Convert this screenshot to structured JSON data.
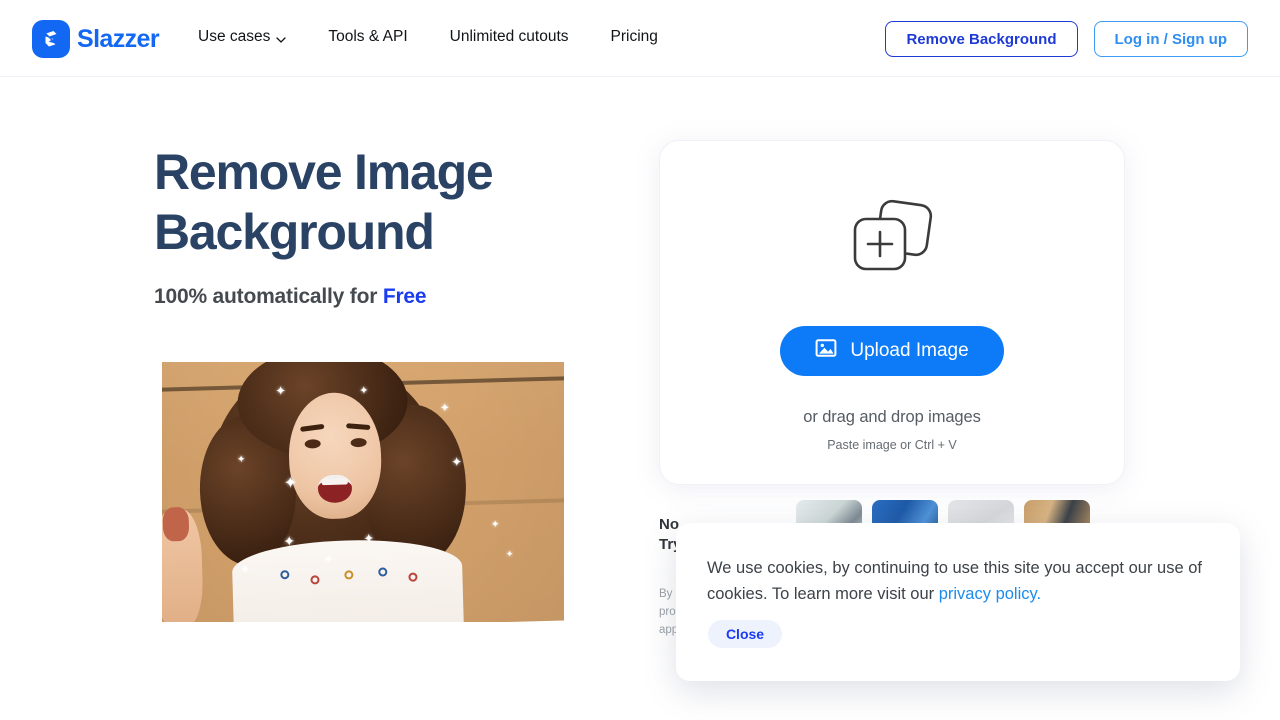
{
  "header": {
    "logo": {
      "text": "Slazzer",
      "icon": "slazzer-logo-icon",
      "brand_color": "#1268f3"
    },
    "nav": [
      {
        "label": "Use cases",
        "has_dropdown": true
      },
      {
        "label": "Tools & API",
        "has_dropdown": false
      },
      {
        "label": "Unlimited cutouts",
        "has_dropdown": false
      },
      {
        "label": "Pricing",
        "has_dropdown": false
      }
    ],
    "actions": {
      "remove_background": "Remove Background",
      "login_signup": "Log in / Sign up"
    }
  },
  "hero": {
    "headline": "Remove Image Background",
    "subhead_prefix": "100% automatically for ",
    "subhead_highlight": "Free",
    "photo_alt": "woman-with-curly-hair-photo"
  },
  "upload": {
    "stack_icon": "add-images-icon",
    "button_label": "Upload Image",
    "button_icon": "image-icon",
    "drag_text": "or drag and drop images",
    "paste_text": "Paste image or Ctrl + V",
    "button_color": "#0d7bf7"
  },
  "thumbnails": [
    {
      "name": "sample-1"
    },
    {
      "name": "sample-2"
    },
    {
      "name": "sample-3"
    },
    {
      "name": "sample-4"
    }
  ],
  "promo": {
    "title": "No\nTry",
    "body": "By u\npro\napp"
  },
  "cookie": {
    "message_part1": "We use cookies, by continuing to use this site you accept our use of cookies. To learn more visit our ",
    "link_label": "privacy policy",
    "message_part2": ".",
    "close_label": "Close",
    "link_color": "#1b8bf0"
  }
}
